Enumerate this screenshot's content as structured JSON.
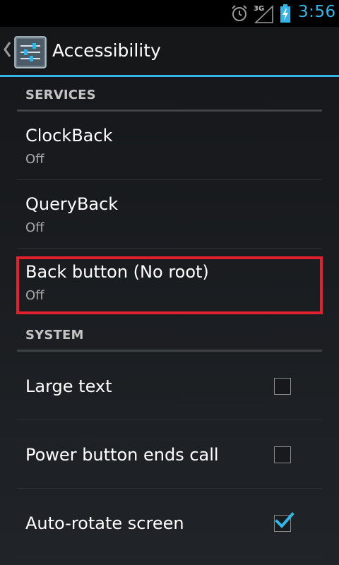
{
  "status_bar": {
    "network_label": "3G",
    "time": "3:56",
    "accent_color": "#33b5e5"
  },
  "action_bar": {
    "title": "Accessibility",
    "app_icon": "settings-sliders-icon",
    "up_icon": "up-caret-icon"
  },
  "sections": {
    "services": "SERVICES",
    "system": "SYSTEM"
  },
  "services": [
    {
      "title": "ClockBack",
      "summary": "Off"
    },
    {
      "title": "QueryBack",
      "summary": "Off"
    },
    {
      "title": "Back button (No root)",
      "summary": "Off"
    }
  ],
  "system": [
    {
      "title": "Large text",
      "checked": false
    },
    {
      "title": "Power button ends call",
      "checked": false
    },
    {
      "title": "Auto-rotate screen",
      "checked": true
    }
  ],
  "highlight_color": "#e5202e"
}
